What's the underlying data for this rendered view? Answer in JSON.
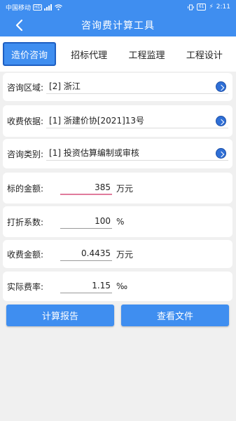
{
  "status": {
    "carrier": "中国移动",
    "hd": "HD",
    "signal": "4G",
    "battery": "61",
    "time": "2:11"
  },
  "header": {
    "title": "咨询费计算工具"
  },
  "tabs": [
    {
      "label": "造价咨询",
      "active": true
    },
    {
      "label": "招标代理",
      "active": false
    },
    {
      "label": "工程监理",
      "active": false
    },
    {
      "label": "工程设计",
      "active": false
    }
  ],
  "selects": [
    {
      "label": "咨询区域:",
      "value": "[2] 浙江"
    },
    {
      "label": "收费依据:",
      "value": "[1] 浙建价协[2021]13号"
    },
    {
      "label": "咨询类别:",
      "value": "[1] 投资估算编制或审核"
    }
  ],
  "fields": [
    {
      "label": "标的金额:",
      "value": "385",
      "unit": "万元"
    },
    {
      "label": "打折系数:",
      "value": "100",
      "unit": "%"
    },
    {
      "label": "收费金额:",
      "value": "0.4435",
      "unit": "万元"
    },
    {
      "label": "实际费率:",
      "value": "1.15",
      "unit": "‰"
    }
  ],
  "buttons": {
    "calculate": "计算报告",
    "view": "查看文件"
  },
  "colors": {
    "accent": "#3f8ef0",
    "focus_underline": "#e07b9c"
  }
}
